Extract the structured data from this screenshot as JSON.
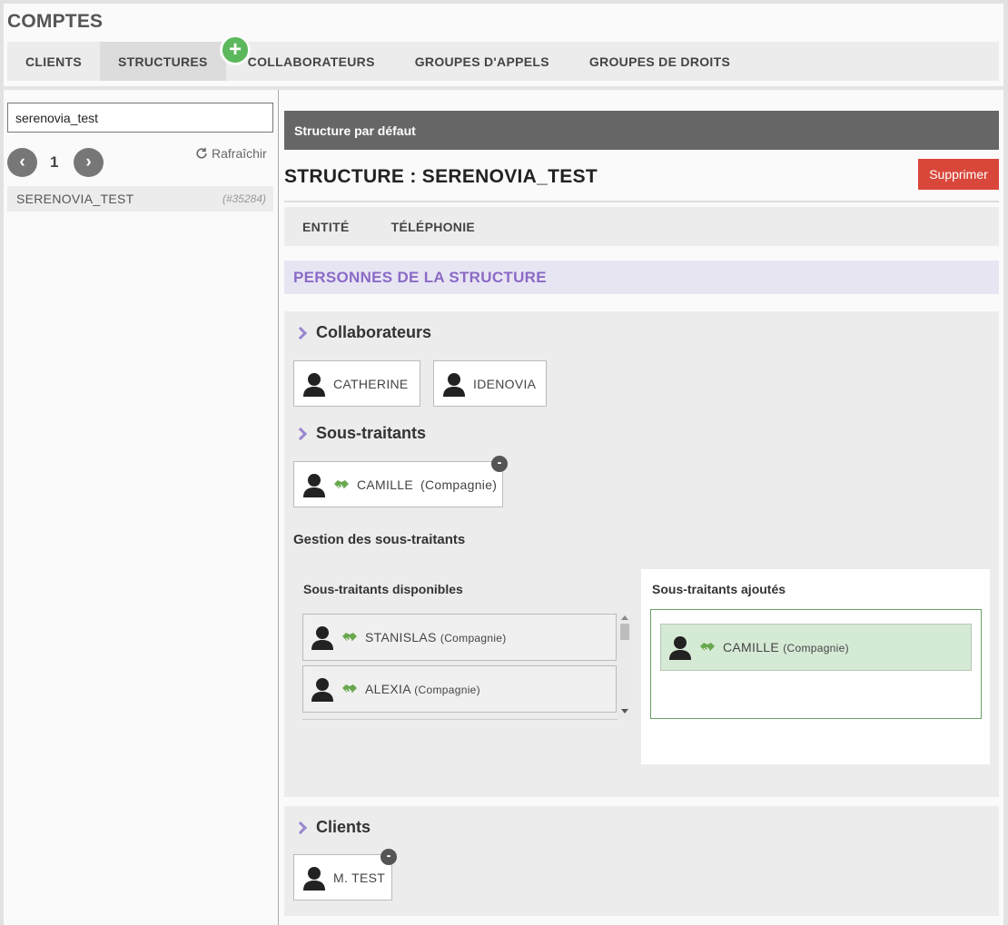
{
  "app": {
    "title": "COMPTES"
  },
  "main_tabs": [
    {
      "label": "CLIENTS"
    },
    {
      "label": "STRUCTURES"
    },
    {
      "label": "COLLABORATEURS"
    },
    {
      "label": "GROUPES D'APPELS"
    },
    {
      "label": "GROUPES DE DROITS"
    }
  ],
  "main_tabs_active": "STRUCTURES",
  "add_badge": "+",
  "sidebar": {
    "search_value": "serenovia_test",
    "pager": {
      "prev": "‹",
      "page": "1",
      "next": "›"
    },
    "refresh_label": "Rafraîchir",
    "items": [
      {
        "name": "SERENOVIA_TEST",
        "id": "(#35284)"
      }
    ]
  },
  "detail": {
    "default_bar": "Structure par défaut",
    "title": "STRUCTURE : SERENOVIA_TEST",
    "delete_label": "Supprimer",
    "sub_tabs": [
      {
        "label": "ENTITÉ"
      },
      {
        "label": "TÉLÉPHONIE"
      }
    ],
    "people_header": "PERSONNES DE LA STRUCTURE",
    "collaborateurs": {
      "title": "Collaborateurs",
      "items": [
        {
          "name": "CATHERINE"
        },
        {
          "name": "IDENOVIA"
        }
      ]
    },
    "sous_traitants": {
      "title": "Sous-traitants",
      "items": [
        {
          "name": "CAMILLE",
          "company": "(Compagnie)"
        }
      ],
      "remove_label": "-"
    },
    "gestion": {
      "title": "Gestion des sous-traitants",
      "available_title": "Sous-traitants disponibles",
      "available": [
        {
          "name": "STANISLAS",
          "company": "(Compagnie)"
        },
        {
          "name": "ALEXIA",
          "company": "(Compagnie)"
        }
      ],
      "added_title": "Sous-traitants ajoutés",
      "added": [
        {
          "name": "CAMILLE",
          "company": "(Compagnie)"
        }
      ]
    },
    "clients": {
      "title": "Clients",
      "items": [
        {
          "name": "M. TEST"
        }
      ],
      "remove_label": "-"
    }
  },
  "colors": {
    "accent_purple": "#8a6ac6",
    "delete_red": "#d9473a",
    "add_green": "#5cb85c",
    "added_green_bg": "#d5ead5",
    "header_dark": "#666666"
  }
}
